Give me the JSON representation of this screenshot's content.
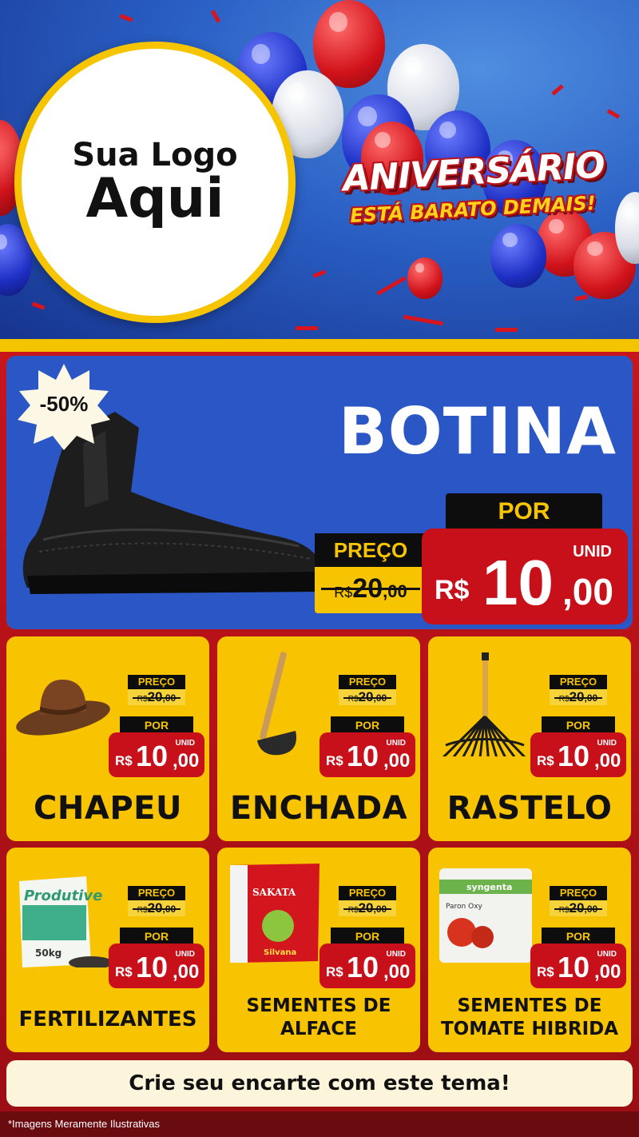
{
  "header": {
    "logo_line1": "Sua Logo",
    "logo_line2": "Aqui",
    "event_title": "ANIVERSÁRIO",
    "event_subtitle": "ESTÁ BARATO DEMAIS!"
  },
  "featured": {
    "name": "BOTINA",
    "discount_badge": "-50%",
    "old_price_label": "PREÇO",
    "old_price": {
      "currency": "R$",
      "integer": "20",
      "cents": ",00"
    },
    "new_price_label": "POR",
    "unit": "UNID",
    "new_price": {
      "currency": "R$",
      "integer": "10",
      "cents": ",00"
    }
  },
  "products": [
    {
      "name": "CHAPEU",
      "old_label": "PREÇO",
      "old_cur": "R$",
      "old_int": "20",
      "old_cents": ",00",
      "por": "POR",
      "unid": "UNID",
      "cur": "R$",
      "int": "10",
      "cents": ",00"
    },
    {
      "name": "ENCHADA",
      "old_label": "PREÇO",
      "old_cur": "R$",
      "old_int": "20",
      "old_cents": ",00",
      "por": "POR",
      "unid": "UNID",
      "cur": "R$",
      "int": "10",
      "cents": ",00"
    },
    {
      "name": "RASTELO",
      "old_label": "PREÇO",
      "old_cur": "R$",
      "old_int": "20",
      "old_cents": ",00",
      "por": "POR",
      "unid": "UNID",
      "cur": "R$",
      "int": "10",
      "cents": ",00"
    },
    {
      "name": "FERTILIZANTES",
      "old_label": "PREÇO",
      "old_cur": "R$",
      "old_int": "20",
      "old_cents": ",00",
      "por": "POR",
      "unid": "UNID",
      "cur": "R$",
      "int": "10",
      "cents": ",00",
      "package_brand": "Produtive",
      "package_weight": "50kg"
    },
    {
      "name_line1": "SEMENTES DE",
      "name_line2": "ALFACE",
      "old_label": "PREÇO",
      "old_cur": "R$",
      "old_int": "20",
      "old_cents": ",00",
      "por": "POR",
      "unid": "UNID",
      "cur": "R$",
      "int": "10",
      "cents": ",00",
      "package_brand": "SAKATA",
      "package_label": "Silvana"
    },
    {
      "name_line1": "SEMENTES DE",
      "name_line2": "TOMATE HIBRIDA",
      "old_label": "PREÇO",
      "old_cur": "R$",
      "old_int": "20",
      "old_cents": ",00",
      "por": "POR",
      "unid": "UNID",
      "cur": "R$",
      "int": "10",
      "cents": ",00",
      "package_brand": "syngenta",
      "package_label": "Paron Oxy"
    }
  ],
  "cta": "Crie seu encarte com este tema!",
  "disclaimer": "*Imagens Meramente Ilustrativas",
  "colors": {
    "header_blue": "#2a5fc4",
    "accent_yellow": "#f6c400",
    "price_red": "#c8101a",
    "background_red": "#c8151c"
  }
}
